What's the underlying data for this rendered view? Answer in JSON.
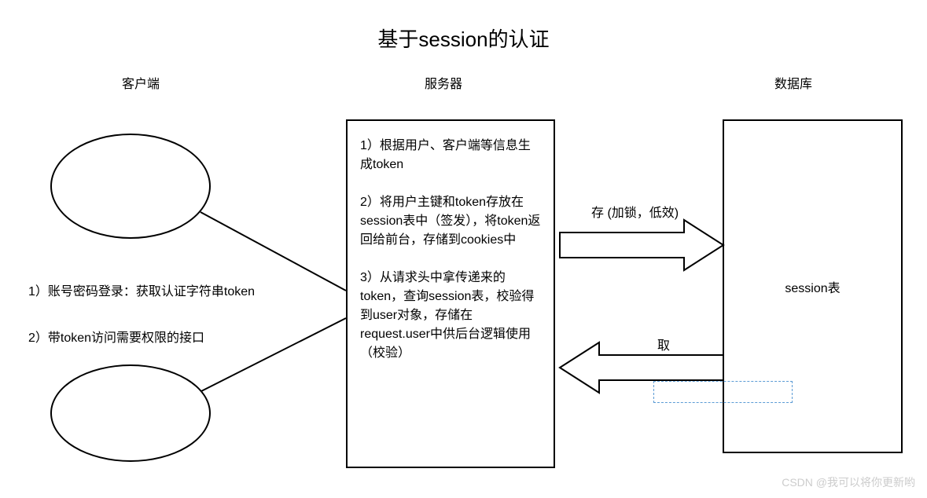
{
  "title": "基于session的认证",
  "columns": {
    "client": "客户端",
    "server": "服务器",
    "database": "数据库"
  },
  "client": {
    "step1": "1）账号密码登录：获取认证字符串token",
    "step2": "2）带token访问需要权限的接口"
  },
  "server": {
    "step1": "1）根据用户、客户端等信息生成token",
    "step2": "2）将用户主键和token存放在session表中（签发），将token返回给前台，存储到cookies中",
    "step3": "3）从请求头中拿传递来的token，查询session表，校验得到user对象，存储在request.user中供后台逻辑使用（校验）"
  },
  "database": {
    "content": "session表"
  },
  "arrows": {
    "store": "存 (加锁，低效)",
    "fetch": "取"
  },
  "watermark": "CSDN @我可以将你更新哟"
}
